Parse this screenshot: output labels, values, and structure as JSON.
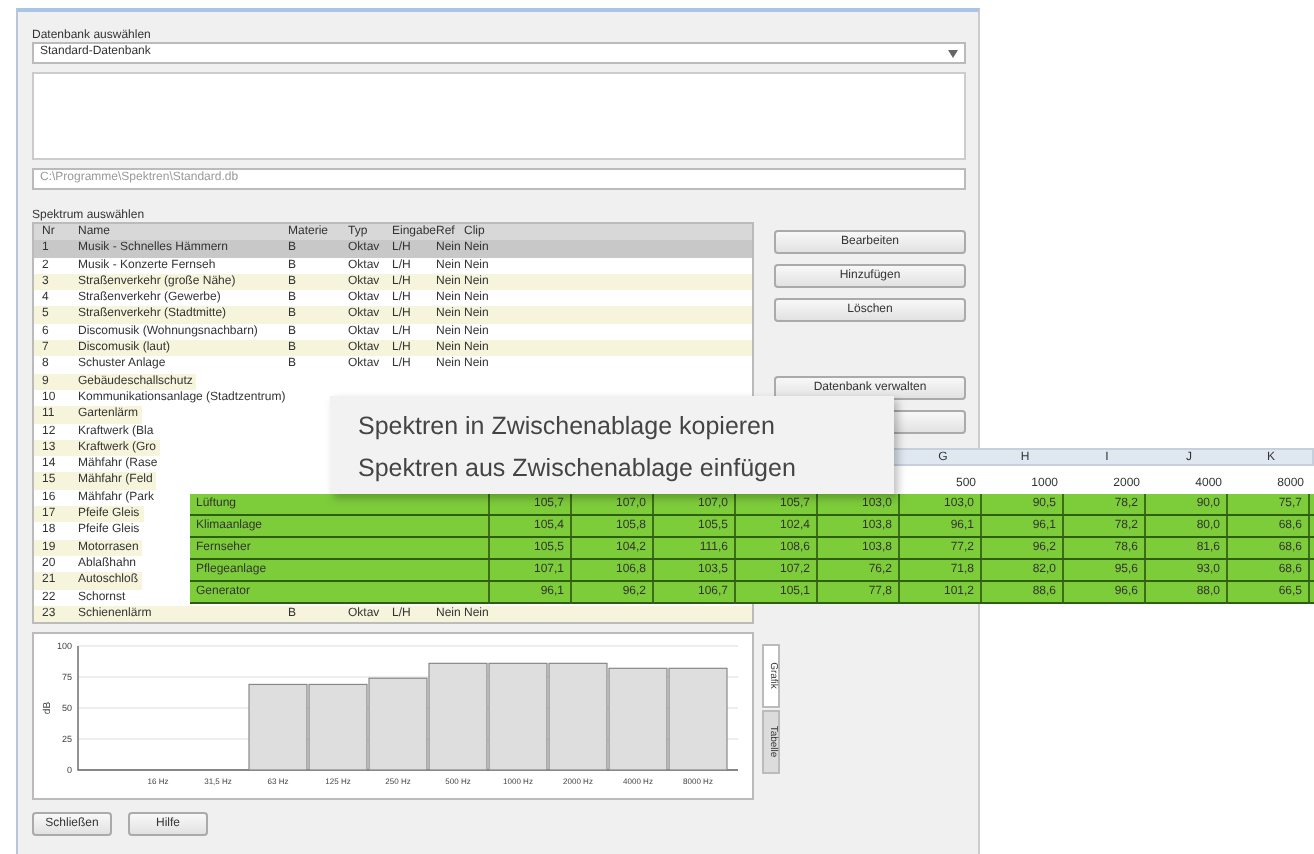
{
  "database": {
    "label": "Datenbank auswählen",
    "value": "Standard-Datenbank",
    "path": "C:\\Programme\\Spektren\\Standard.db"
  },
  "spectra": {
    "label": "Spektrum auswählen",
    "columns": [
      "Nr",
      "Name",
      "Materie",
      "Typ",
      "Eingabe",
      "Ref",
      "Clip"
    ],
    "rows": [
      {
        "cells": [
          "1",
          "Musik - Schnelles Hämmern",
          "B",
          "Oktav",
          "L/H",
          "Nein",
          "Nein"
        ],
        "selected": true
      },
      {
        "cells": [
          "2",
          "Musik - Konzerte Fernseh",
          "B",
          "Oktav",
          "L/H",
          "Nein",
          "Nein"
        ],
        "selected": false
      },
      {
        "cells": [
          "3",
          "Straßenverkehr (große Nähe)",
          "B",
          "Oktav",
          "L/H",
          "Nein",
          "Nein"
        ],
        "selected": false
      },
      {
        "cells": [
          "4",
          "Straßenverkehr (Gewerbe)",
          "B",
          "Oktav",
          "L/H",
          "Nein",
          "Nein"
        ],
        "selected": false
      },
      {
        "cells": [
          "5",
          "Straßenverkehr (Stadtmitte)",
          "B",
          "Oktav",
          "L/H",
          "Nein",
          "Nein"
        ],
        "selected": false
      },
      {
        "cells": [
          "6",
          "Discomusik (Wohnungsnachbarn)",
          "B",
          "Oktav",
          "L/H",
          "Nein",
          "Nein"
        ],
        "selected": false
      },
      {
        "cells": [
          "7",
          "Discomusik (laut)",
          "B",
          "Oktav",
          "L/H",
          "Nein",
          "Nein"
        ],
        "selected": false
      },
      {
        "cells": [
          "8",
          "Schuster Anlage",
          "B",
          "Oktav",
          "L/H",
          "Nein",
          "Nein"
        ],
        "selected": false
      },
      {
        "cells": [
          "9",
          "Gebäudeschallschutz"
        ],
        "selected": false
      },
      {
        "cells": [
          "10",
          "Kommunikationsanlage (Stadtzentrum)"
        ],
        "selected": false
      },
      {
        "cells": [
          "11",
          "Gartenlärm"
        ],
        "selected": false
      },
      {
        "cells": [
          "12",
          "Kraftwerk (Bla"
        ],
        "selected": false
      },
      {
        "cells": [
          "13",
          "Kraftwerk (Gro"
        ],
        "selected": false
      },
      {
        "cells": [
          "14",
          "Mähfahr (Rase"
        ],
        "selected": false
      },
      {
        "cells": [
          "15",
          "Mähfahr (Feld"
        ],
        "selected": false
      },
      {
        "cells": [
          "16",
          "Mähfahr (Park"
        ],
        "selected": false
      },
      {
        "cells": [
          "17",
          "Pfeife Gleis"
        ],
        "selected": false
      },
      {
        "cells": [
          "18",
          "Pfeife Gleis"
        ],
        "selected": false
      },
      {
        "cells": [
          "19",
          "Motorrasen"
        ],
        "selected": false
      },
      {
        "cells": [
          "20",
          "Ablaßhahn"
        ],
        "selected": false
      },
      {
        "cells": [
          "21",
          "Autoschloß"
        ],
        "selected": false
      },
      {
        "cells": [
          "22",
          "Schornst"
        ],
        "selected": false
      },
      {
        "cells": [
          "23",
          "Schienenlärm",
          "B",
          "Oktav",
          "L/H",
          "Nein",
          "Nein"
        ],
        "selected": false
      }
    ]
  },
  "buttons": [
    "Bearbeiten",
    "Hinzufügen",
    "Löschen",
    "Datenbank verwalten"
  ],
  "chart": {
    "tabs": [
      {
        "label": "Grafik",
        "selected": true
      },
      {
        "label": "Tabelle",
        "selected": false
      }
    ],
    "chart_data": {
      "type": "bar",
      "ylabel": "dB",
      "categories": [
        "16 Hz",
        "31,5 Hz",
        "63 Hz",
        "125 Hz",
        "250 Hz",
        "500 Hz",
        "1000 Hz",
        "2000 Hz",
        "4000 Hz",
        "8000 Hz"
      ],
      "values": [
        null,
        null,
        69,
        69,
        74,
        86,
        86,
        86,
        82,
        82
      ],
      "ylim": [
        0,
        100
      ],
      "grid": true,
      "yticks": [
        0,
        25,
        50,
        75,
        100
      ]
    }
  },
  "footer_buttons": [
    "Schließen",
    "Hilfe"
  ],
  "context_menu": [
    "Spektren in Zwischenablage kopieren",
    "Spektren aus Zwischenablage einfügen"
  ],
  "spreadsheet": {
    "column_letters": [
      "G",
      "H",
      "I",
      "J",
      "K"
    ],
    "header": [
      "500",
      "1000",
      "2000",
      "4000",
      "8000"
    ],
    "rows": [
      {
        "label": "Lüftung",
        "values": [
          "105,7",
          "107,0",
          "107,0",
          "105,7",
          "103,0",
          "103,0",
          "90,5",
          "78,2",
          "90,0",
          "75,7"
        ]
      },
      {
        "label": "Klimaanlage",
        "values": [
          "105,4",
          "105,8",
          "105,5",
          "102,4",
          "103,8",
          "96,1",
          "96,1",
          "78,2",
          "80,0",
          "68,6"
        ]
      },
      {
        "label": "Fernseher",
        "values": [
          "105,5",
          "104,2",
          "111,6",
          "108,6",
          "103,8",
          "77,2",
          "96,2",
          "78,6",
          "81,6",
          "68,6"
        ]
      },
      {
        "label": "Pflegeanlage",
        "values": [
          "107,1",
          "106,8",
          "103,5",
          "107,2",
          "76,2",
          "71,8",
          "82,0",
          "95,6",
          "93,0",
          "68,6"
        ]
      },
      {
        "label": "Generator",
        "values": [
          "96,1",
          "96,2",
          "106,7",
          "105,1",
          "77,8",
          "101,2",
          "88,6",
          "96,6",
          "88,0",
          "66,5"
        ]
      }
    ]
  }
}
